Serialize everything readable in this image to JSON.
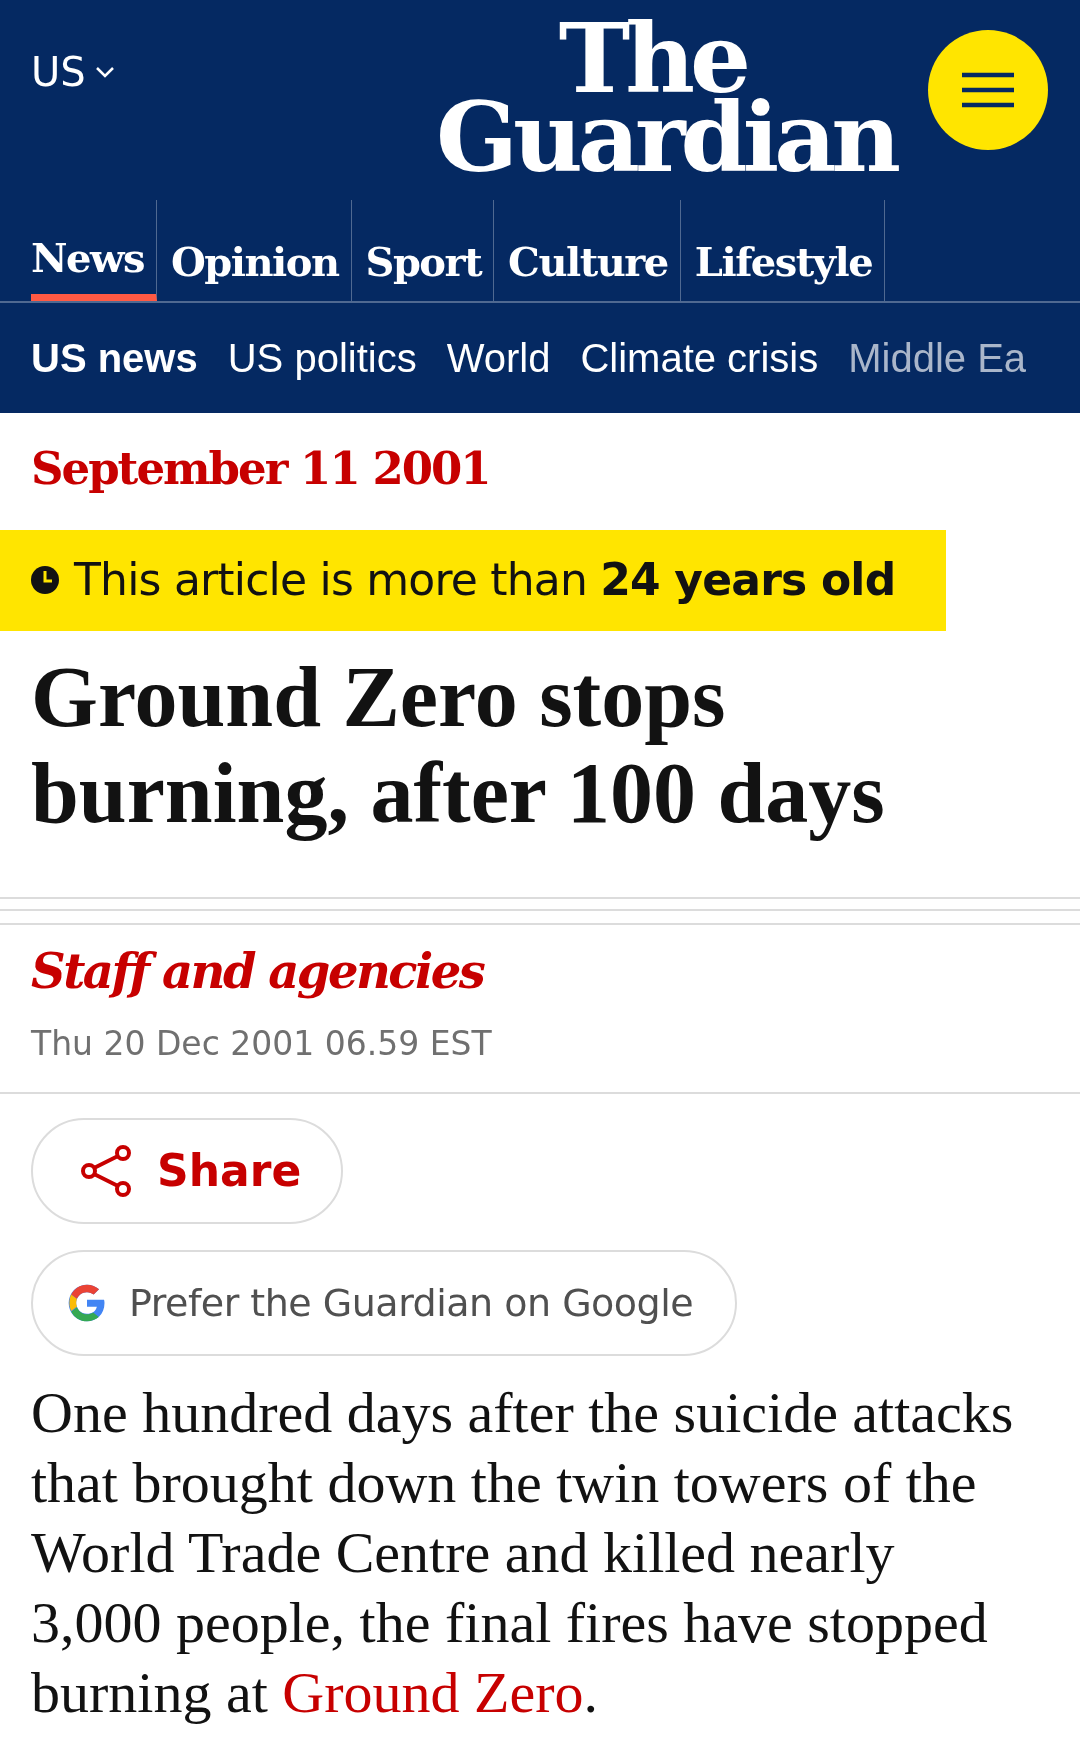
{
  "header": {
    "edition": "US",
    "logo": [
      "The",
      "Guardian"
    ]
  },
  "pillars": [
    {
      "label": "News",
      "selected": true
    },
    {
      "label": "Opinion",
      "selected": false
    },
    {
      "label": "Sport",
      "selected": false
    },
    {
      "label": "Culture",
      "selected": false
    },
    {
      "label": "Lifestyle",
      "selected": false
    }
  ],
  "subnav": [
    {
      "label": "US news",
      "selected": true
    },
    {
      "label": "US politics",
      "selected": false
    },
    {
      "label": "World",
      "selected": false
    },
    {
      "label": "Climate crisis",
      "selected": false
    },
    {
      "label": "Middle Ea",
      "selected": false
    }
  ],
  "article": {
    "series": "September 11 2001",
    "age_notice": {
      "text": "This article is more than ",
      "emphasis": "24 years old"
    },
    "headline": "Ground Zero stops burning, after 100 days",
    "byline": "Staff and agencies",
    "dateline": "Thu 20 Dec 2001 06.59 EST",
    "share_label": "Share",
    "google_label": "Prefer the Guardian on Google",
    "paragraph": {
      "text": "One hundred days after the suicide attacks that brought down the twin towers of the World Trade Centre and killed nearly 3,000 people, the final fires have stopped burning at ",
      "link": "Ground Zero",
      "end": "."
    }
  }
}
